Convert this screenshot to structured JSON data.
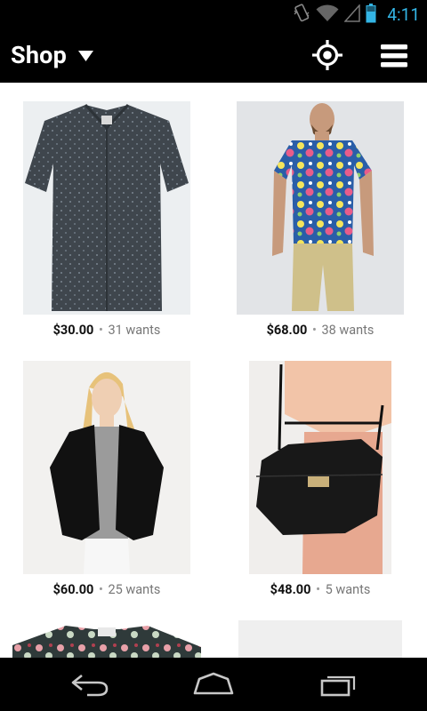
{
  "status_bar": {
    "time": "4:11",
    "icons": [
      "vibrate-icon",
      "wifi-icon",
      "signal-icon",
      "battery-icon"
    ]
  },
  "action_bar": {
    "title": "Shop",
    "dropdown_icon": "triangle-down-icon",
    "actions": [
      "locate-icon",
      "menu-icon"
    ]
  },
  "products": [
    {
      "name": "patterned-button-down-shirt",
      "price": "$30.00",
      "wants": "31 wants"
    },
    {
      "name": "floral-tshirt",
      "price": "$68.00",
      "wants": "38 wants"
    },
    {
      "name": "black-blazer",
      "price": "$60.00",
      "wants": "25 wants"
    },
    {
      "name": "black-handbag",
      "price": "$48.00",
      "wants": "5 wants"
    },
    {
      "name": "floral-shirt",
      "price": "",
      "wants": ""
    },
    {
      "name": "item-placeholder",
      "price": "",
      "wants": ""
    }
  ],
  "separator": "•",
  "nav_bar": [
    "back-icon",
    "home-icon",
    "recent-apps-icon"
  ],
  "colors": {
    "accent": "#33b5e5",
    "bar": "#000000",
    "price": "#111111",
    "wants": "#777777"
  }
}
